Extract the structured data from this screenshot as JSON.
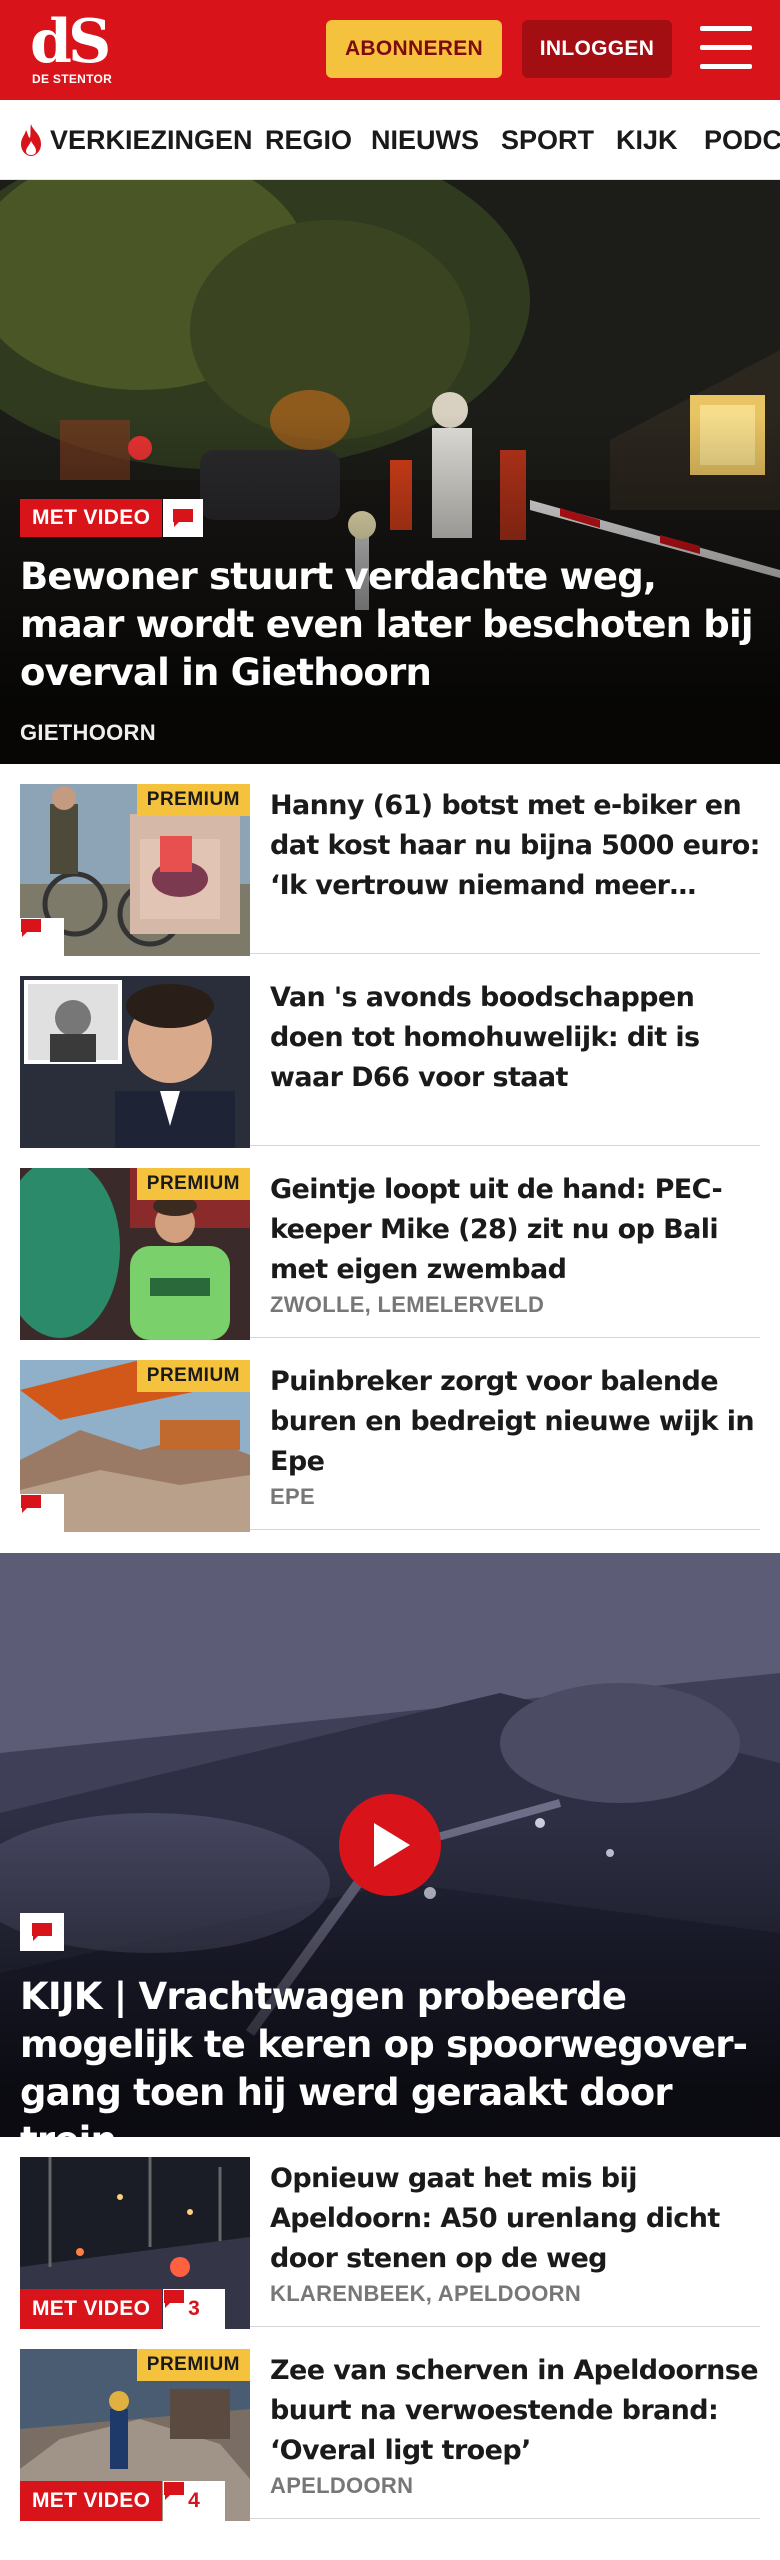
{
  "header": {
    "logo_text": "dS",
    "logo_sub": "DE STENTOR",
    "subscribe_label": "ABONNEREN",
    "login_label": "INLOGGEN"
  },
  "nav": {
    "items": [
      "VERKIEZINGEN",
      "REGIO",
      "NIEUWS",
      "SPORT",
      "KIJK",
      "PODC"
    ]
  },
  "hero": {
    "badge": "MET VIDEO",
    "title": "Bewoner stuurt verdachte weg, maar wordt even later beschoten bij overval in Giethoorn",
    "location": "GIETHOORN"
  },
  "articles": [
    {
      "title": "Hanny (61) botst met e-biker en dat kost haar nu bijna 5000 euro: ‘Ik vertrouw niemand meer…",
      "location": "",
      "premium": "PREMIUM"
    },
    {
      "title": "Van 's avonds boodschappen doen tot homohuwelijk: dit is waar D66 voor staat",
      "location": ""
    },
    {
      "title": "Geintje loopt uit de hand: PEC-keeper Mike (28) zit nu op Bali met eigen zwembad",
      "location": "ZWOLLE, LEMELERVELD",
      "premium": "PREMIUM"
    },
    {
      "title": "Puinbreker zorgt voor balende buren en bedreigt nieuwe wijk in Epe",
      "location": "EPE",
      "premium": "PREMIUM"
    }
  ],
  "video_hero": {
    "title": "KIJK | Vrachtwagen probeerde mogelijk te keren op spoorwegover-gang toen hij werd geraakt door trein"
  },
  "articles2": [
    {
      "title": "Opnieuw gaat het mis bij Apeldoorn: A50 urenlang dicht door stenen op de weg",
      "location": "KLARENBEEK, APELDOORN",
      "badge": "MET VIDEO",
      "comments": "3"
    },
    {
      "title": "Zee van scherven in Apeldoornse buurt na verwoestende brand: ‘Overal ligt troep’",
      "location": "APELDOORN",
      "badge": "MET VIDEO",
      "comments": "4",
      "premium": "PREMIUM"
    }
  ],
  "colors": {
    "brand_red": "#d8131a",
    "premium_yellow": "#f5c23e",
    "login_dark_red": "#a30e13"
  },
  "icons": [
    "flame-icon",
    "comment-icon",
    "menu-icon",
    "play-icon"
  ]
}
